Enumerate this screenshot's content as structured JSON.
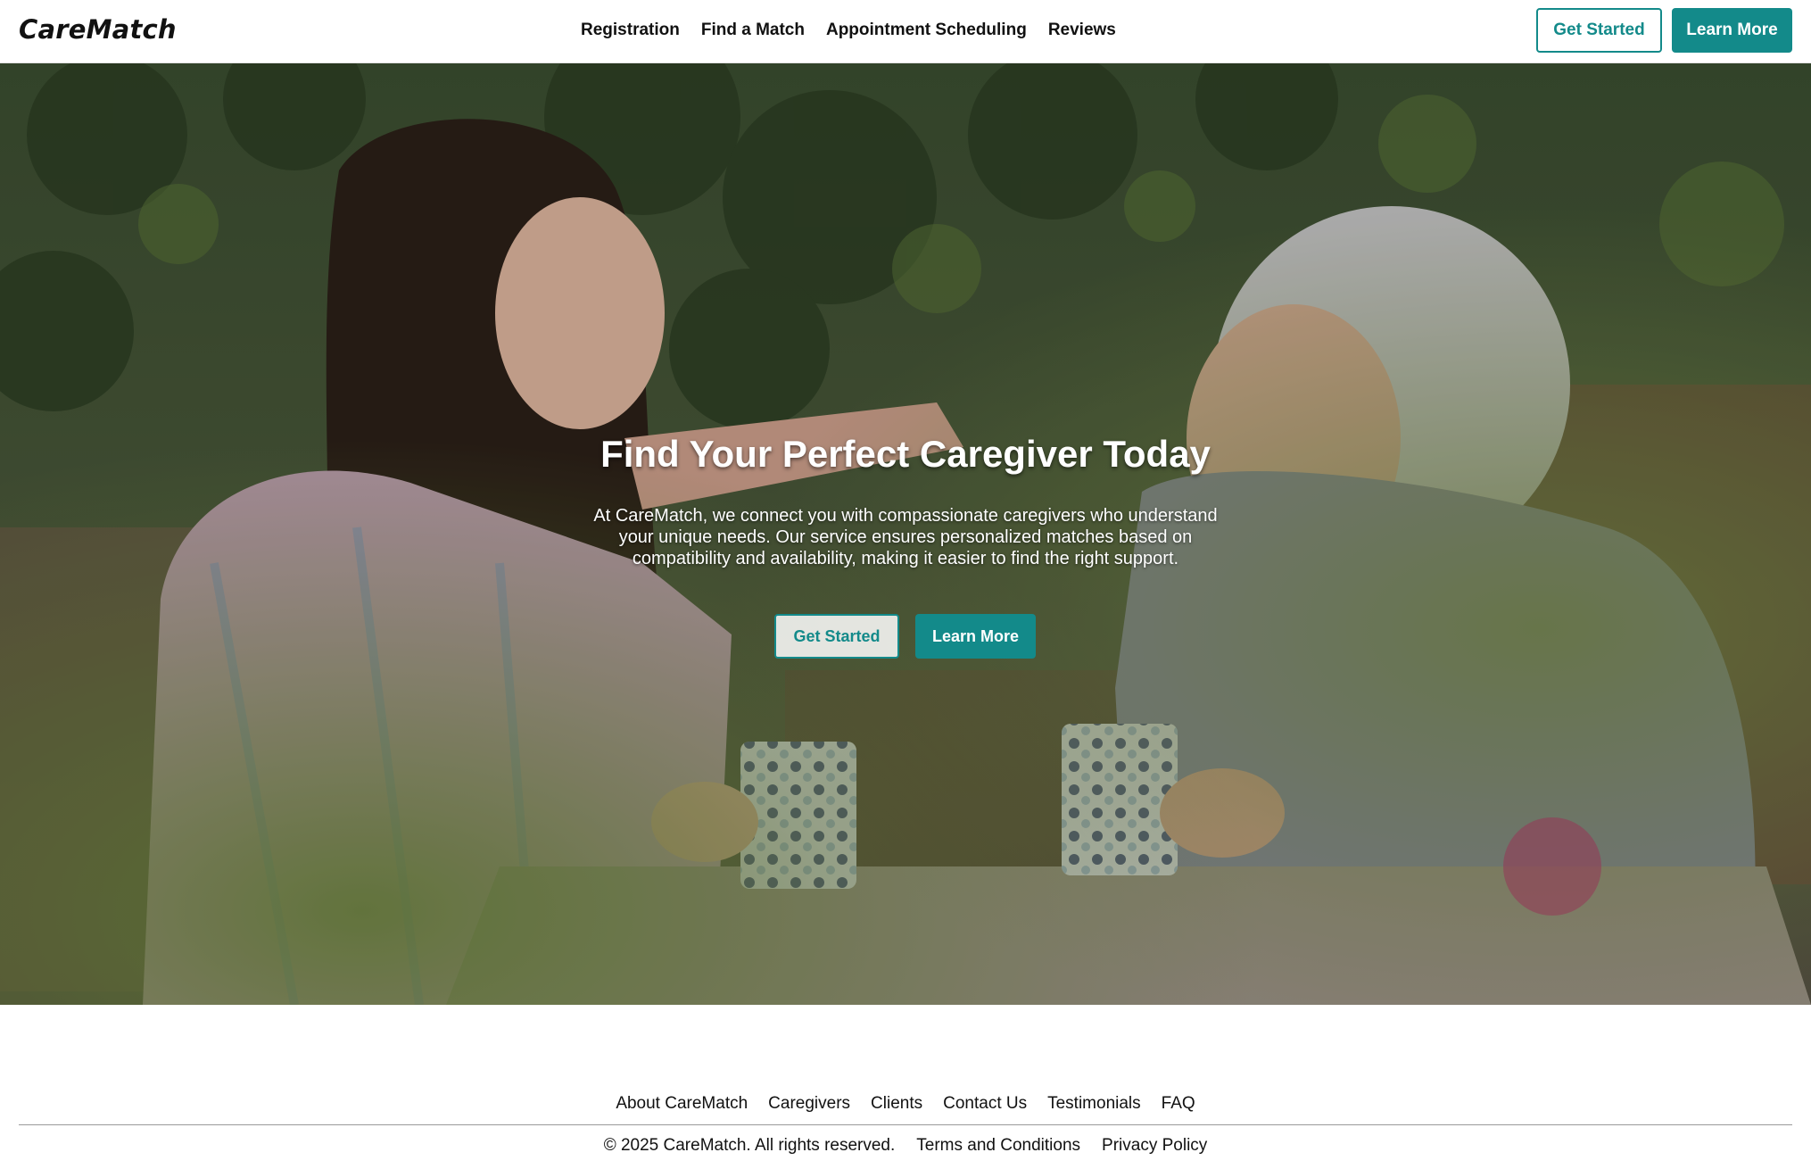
{
  "brand": {
    "name": "CareMatch",
    "accent": "#138a8a"
  },
  "nav": {
    "items": [
      {
        "label": "Registration"
      },
      {
        "label": "Find a Match"
      },
      {
        "label": "Appointment Scheduling"
      },
      {
        "label": "Reviews"
      }
    ]
  },
  "header_buttons": {
    "get_started": "Get Started",
    "learn_more": "Learn More"
  },
  "hero": {
    "title": "Find Your Perfect Caregiver Today",
    "text": "At CareMatch, we connect you with compassionate caregivers who understand your unique needs. Our service ensures personalized matches based on compatibility and availability, making it easier to find the right support.",
    "get_started": "Get Started",
    "learn_more": "Learn More",
    "image": "Young woman and elderly woman smiling at each other over polka-dot mugs in a garden"
  },
  "footer": {
    "links": [
      {
        "label": "About CareMatch"
      },
      {
        "label": "Caregivers"
      },
      {
        "label": "Clients"
      },
      {
        "label": "Contact Us"
      },
      {
        "label": "Testimonials"
      },
      {
        "label": "FAQ"
      }
    ],
    "copyright": "© 2025 CareMatch. All rights reserved.",
    "terms": "Terms and Conditions",
    "privacy": "Privacy Policy"
  }
}
